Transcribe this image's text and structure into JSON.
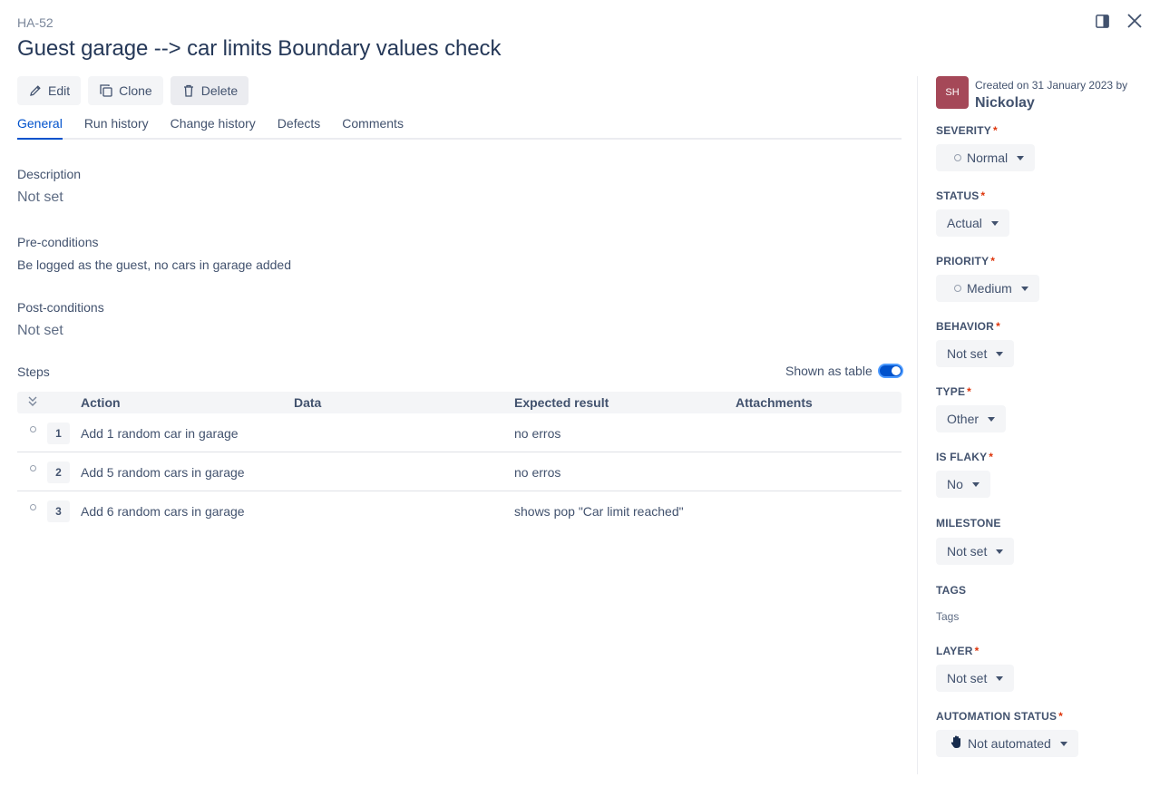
{
  "case": {
    "key": "HA-52",
    "title": "Guest garage --> car limits Boundary values check"
  },
  "toolbar": {
    "edit_label": "Edit",
    "clone_label": "Clone",
    "delete_label": "Delete"
  },
  "tabs": [
    {
      "label": "General",
      "active": true
    },
    {
      "label": "Run history",
      "active": false
    },
    {
      "label": "Change history",
      "active": false
    },
    {
      "label": "Defects",
      "active": false
    },
    {
      "label": "Comments",
      "active": false
    }
  ],
  "general": {
    "description_label": "Description",
    "description_value": "Not set",
    "preconditions_label": "Pre-conditions",
    "preconditions_value": "Be logged as the guest, no cars in garage added",
    "postconditions_label": "Post-conditions",
    "postconditions_value": "Not set"
  },
  "steps": {
    "label": "Steps",
    "toggle_label": "Shown as table",
    "toggle_on": true,
    "columns": [
      "Action",
      "Data",
      "Expected result",
      "Attachments"
    ],
    "rows": [
      {
        "num": "1",
        "action": "Add 1 random car in garage",
        "expected": "no erros"
      },
      {
        "num": "2",
        "action": "Add 5 random cars in garage",
        "expected": "no erros"
      },
      {
        "num": "3",
        "action": "Add 6 random cars in garage",
        "expected": "shows pop \"Car limit reached\""
      }
    ]
  },
  "sidebar": {
    "avatar_initials": "SH",
    "avatar_color": "#a54858",
    "created_text": "Created on 31 January 2023 by",
    "author": "Nickolay",
    "fields": {
      "severity": {
        "label": "Severity",
        "value": "Normal"
      },
      "status": {
        "label": "Status",
        "value": "Actual"
      },
      "priority": {
        "label": "Priority",
        "value": "Medium"
      },
      "behavior": {
        "label": "Behavior",
        "value": "Not set"
      },
      "type": {
        "label": "Type",
        "value": "Other"
      },
      "is_flaky": {
        "label": "Is flaky",
        "value": "No"
      },
      "milestone": {
        "label": "Milestone",
        "value": "Not set"
      },
      "tags": {
        "label": "Tags",
        "value": "Tags"
      },
      "layer": {
        "label": "Layer",
        "value": "Not set"
      },
      "automation_status": {
        "label": "Automation status",
        "value": "Not automated"
      }
    }
  },
  "colors": {
    "accent": "#0052cc",
    "required": "#de350b"
  }
}
